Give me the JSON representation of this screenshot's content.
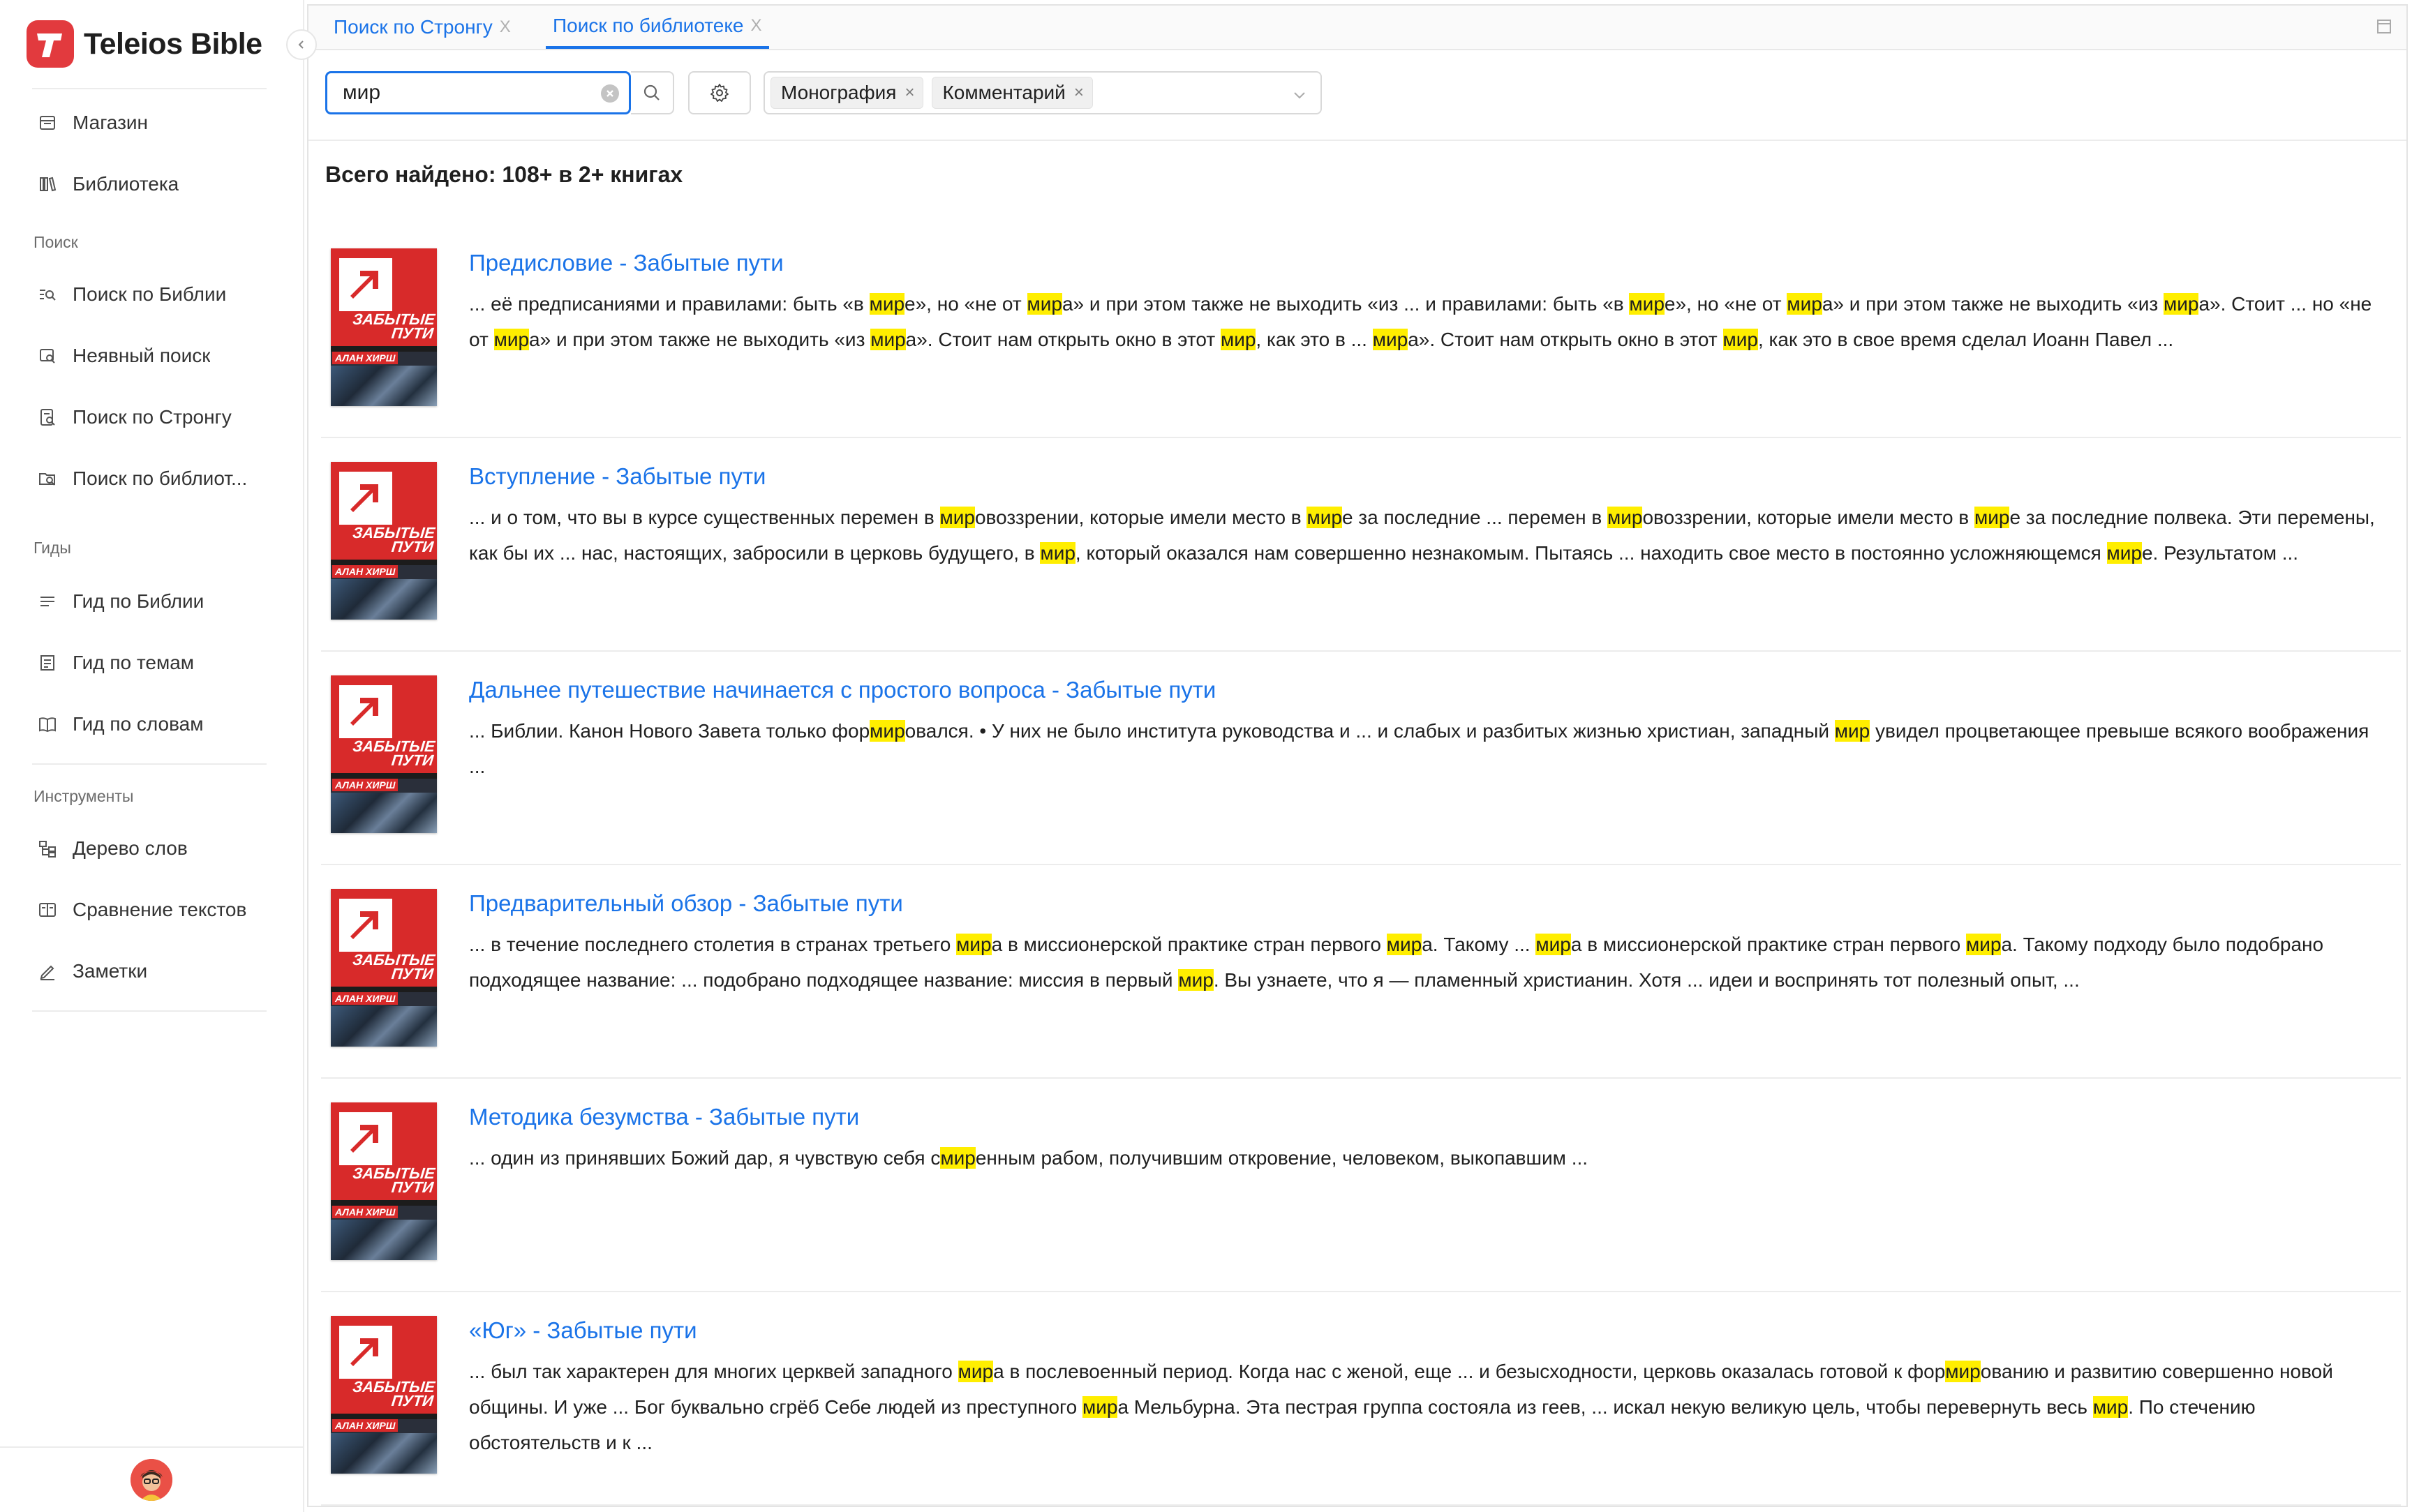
{
  "app": {
    "name": "Teleios Bible"
  },
  "sidebar": {
    "top_items": [
      {
        "label": "Магазин",
        "icon": "store-icon"
      },
      {
        "label": "Библиотека",
        "icon": "library-icon"
      }
    ],
    "sections": [
      {
        "title": "Поиск",
        "items": [
          {
            "label": "Поиск по Библии",
            "icon": "bible-search-icon"
          },
          {
            "label": "Неявный поиск",
            "icon": "implicit-search-icon"
          },
          {
            "label": "Поиск по Стронгу",
            "icon": "strong-search-icon"
          },
          {
            "label": "Поиск по библиот...",
            "icon": "library-search-icon"
          }
        ]
      },
      {
        "title": "Гиды",
        "items": [
          {
            "label": "Гид по Библии",
            "icon": "list-icon"
          },
          {
            "label": "Гид по темам",
            "icon": "topics-icon"
          },
          {
            "label": "Гид по словам",
            "icon": "book-open-icon"
          }
        ]
      },
      {
        "title": "Инструменты",
        "items": [
          {
            "label": "Дерево слов",
            "icon": "tree-icon"
          },
          {
            "label": "Сравнение текстов",
            "icon": "compare-icon"
          },
          {
            "label": "Заметки",
            "icon": "pen-icon"
          }
        ]
      }
    ]
  },
  "tabs": [
    {
      "label": "Поиск по Стронгу",
      "close": "X",
      "active": false
    },
    {
      "label": "Поиск по библиотеке",
      "close": "X",
      "active": true
    }
  ],
  "search": {
    "value": "мир",
    "placeholder": ""
  },
  "filters": {
    "chips": [
      {
        "label": "Монография",
        "close": "×"
      },
      {
        "label": "Комментарий",
        "close": "×"
      }
    ]
  },
  "summary": "Всего найдено: 108+ в 2+ книгах",
  "book_cover": {
    "title_line1": "ЗАБЫТЫЕ",
    "title_line2": "ПУТИ",
    "author": "АЛАН ХИРШ"
  },
  "highlight_color": "#ffee00",
  "accent_color": "#1a73e8",
  "results": [
    {
      "title": "Предисловие - Забытые пути",
      "segments": [
        [
          "... её предписаниями и правилами: быть «в ",
          0
        ],
        [
          "мир",
          1
        ],
        [
          "е», но «не от ",
          0
        ],
        [
          "мир",
          1
        ],
        [
          "а» и при этом также не выходить «из ... и правилами: быть «в ",
          0
        ],
        [
          "мир",
          1
        ],
        [
          "е», но «не от ",
          0
        ],
        [
          "мир",
          1
        ],
        [
          "а» и при этом также не выходить «из ",
          0
        ],
        [
          "мир",
          1
        ],
        [
          "а». Стоит ... но «не от ",
          0
        ],
        [
          "мир",
          1
        ],
        [
          "а» и при этом также не выходить «из ",
          0
        ],
        [
          "мир",
          1
        ],
        [
          "а». Стоит нам открыть окно в этот ",
          0
        ],
        [
          "мир",
          1
        ],
        [
          ", как это в ... ",
          0
        ],
        [
          "мир",
          1
        ],
        [
          "а». Стоит нам открыть окно в этот ",
          0
        ],
        [
          "мир",
          1
        ],
        [
          ", как это в свое время сделал Иоанн Павел ...",
          0
        ]
      ]
    },
    {
      "title": "Вступление - Забытые пути",
      "segments": [
        [
          "... и о том, что вы в курсе существенных перемен в ",
          0
        ],
        [
          "мир",
          1
        ],
        [
          "овоззрении, которые имели место в ",
          0
        ],
        [
          "мир",
          1
        ],
        [
          "е за последние ... перемен в ",
          0
        ],
        [
          "мир",
          1
        ],
        [
          "овоззрении, которые имели место в ",
          0
        ],
        [
          "мир",
          1
        ],
        [
          "е за последние полвека. Эти перемены, как бы их ... нас, настоящих, забросили в церковь будущего, в ",
          0
        ],
        [
          "мир",
          1
        ],
        [
          ", который оказался нам совершенно незнакомым. Пытаясь ... находить свое место в постоянно усложняющемся ",
          0
        ],
        [
          "мир",
          1
        ],
        [
          "е. Результатом ...",
          0
        ]
      ]
    },
    {
      "title": "Дальнее путешествие начинается с простого вопроса - Забытые пути",
      "segments": [
        [
          "... Библии. Канон Нового Завета только фор",
          0
        ],
        [
          "мир",
          1
        ],
        [
          "овался. • У них не было института руководства и ... и слабых и разбитых жизнью христиан, западный ",
          0
        ],
        [
          "мир",
          1
        ],
        [
          " увидел процветающее превыше всякого воображения ...",
          0
        ]
      ]
    },
    {
      "title": "Предварительный обзор - Забытые пути",
      "segments": [
        [
          "... в течение последнего столетия в странах третьего ",
          0
        ],
        [
          "мир",
          1
        ],
        [
          "а в миссионерской практике стран первого ",
          0
        ],
        [
          "мир",
          1
        ],
        [
          "а. Такому ... ",
          0
        ],
        [
          "мир",
          1
        ],
        [
          "а в миссионерской практике стран первого ",
          0
        ],
        [
          "мир",
          1
        ],
        [
          "а. Такому подходу было подобрано подходящее название: ... подобрано подходящее название: миссия в первый ",
          0
        ],
        [
          "мир",
          1
        ],
        [
          ". Вы узнаете, что я — пламенный христианин. Хотя ... идеи и воспринять тот полезный опыт, ...",
          0
        ]
      ]
    },
    {
      "title": "Методика безумства - Забытые пути",
      "segments": [
        [
          "... один из принявших Божий дар, я чувствую себя с",
          0
        ],
        [
          "мир",
          1
        ],
        [
          "енным рабом, получившим откровение, человеком, выкопавшим ...",
          0
        ]
      ]
    },
    {
      "title": "«Юг» - Забытые пути",
      "segments": [
        [
          "... был так характерен для многих церквей западного ",
          0
        ],
        [
          "мир",
          1
        ],
        [
          "а в послевоенный период. Когда нас с женой, еще ... и безысходности, церковь оказалась готовой к фор",
          0
        ],
        [
          "мир",
          1
        ],
        [
          "ованию и развитию совершенно новой общины. И уже ... Бог буквально сгрёб Себе людей из преступного ",
          0
        ],
        [
          "мир",
          1
        ],
        [
          "а Мельбурна. Эта пестрая группа состояла из геев, ... искал некую великую цель, чтобы перевернуть весь ",
          0
        ],
        [
          "мир",
          1
        ],
        [
          ". По стечению обстоятельств и к ...",
          0
        ]
      ]
    }
  ]
}
